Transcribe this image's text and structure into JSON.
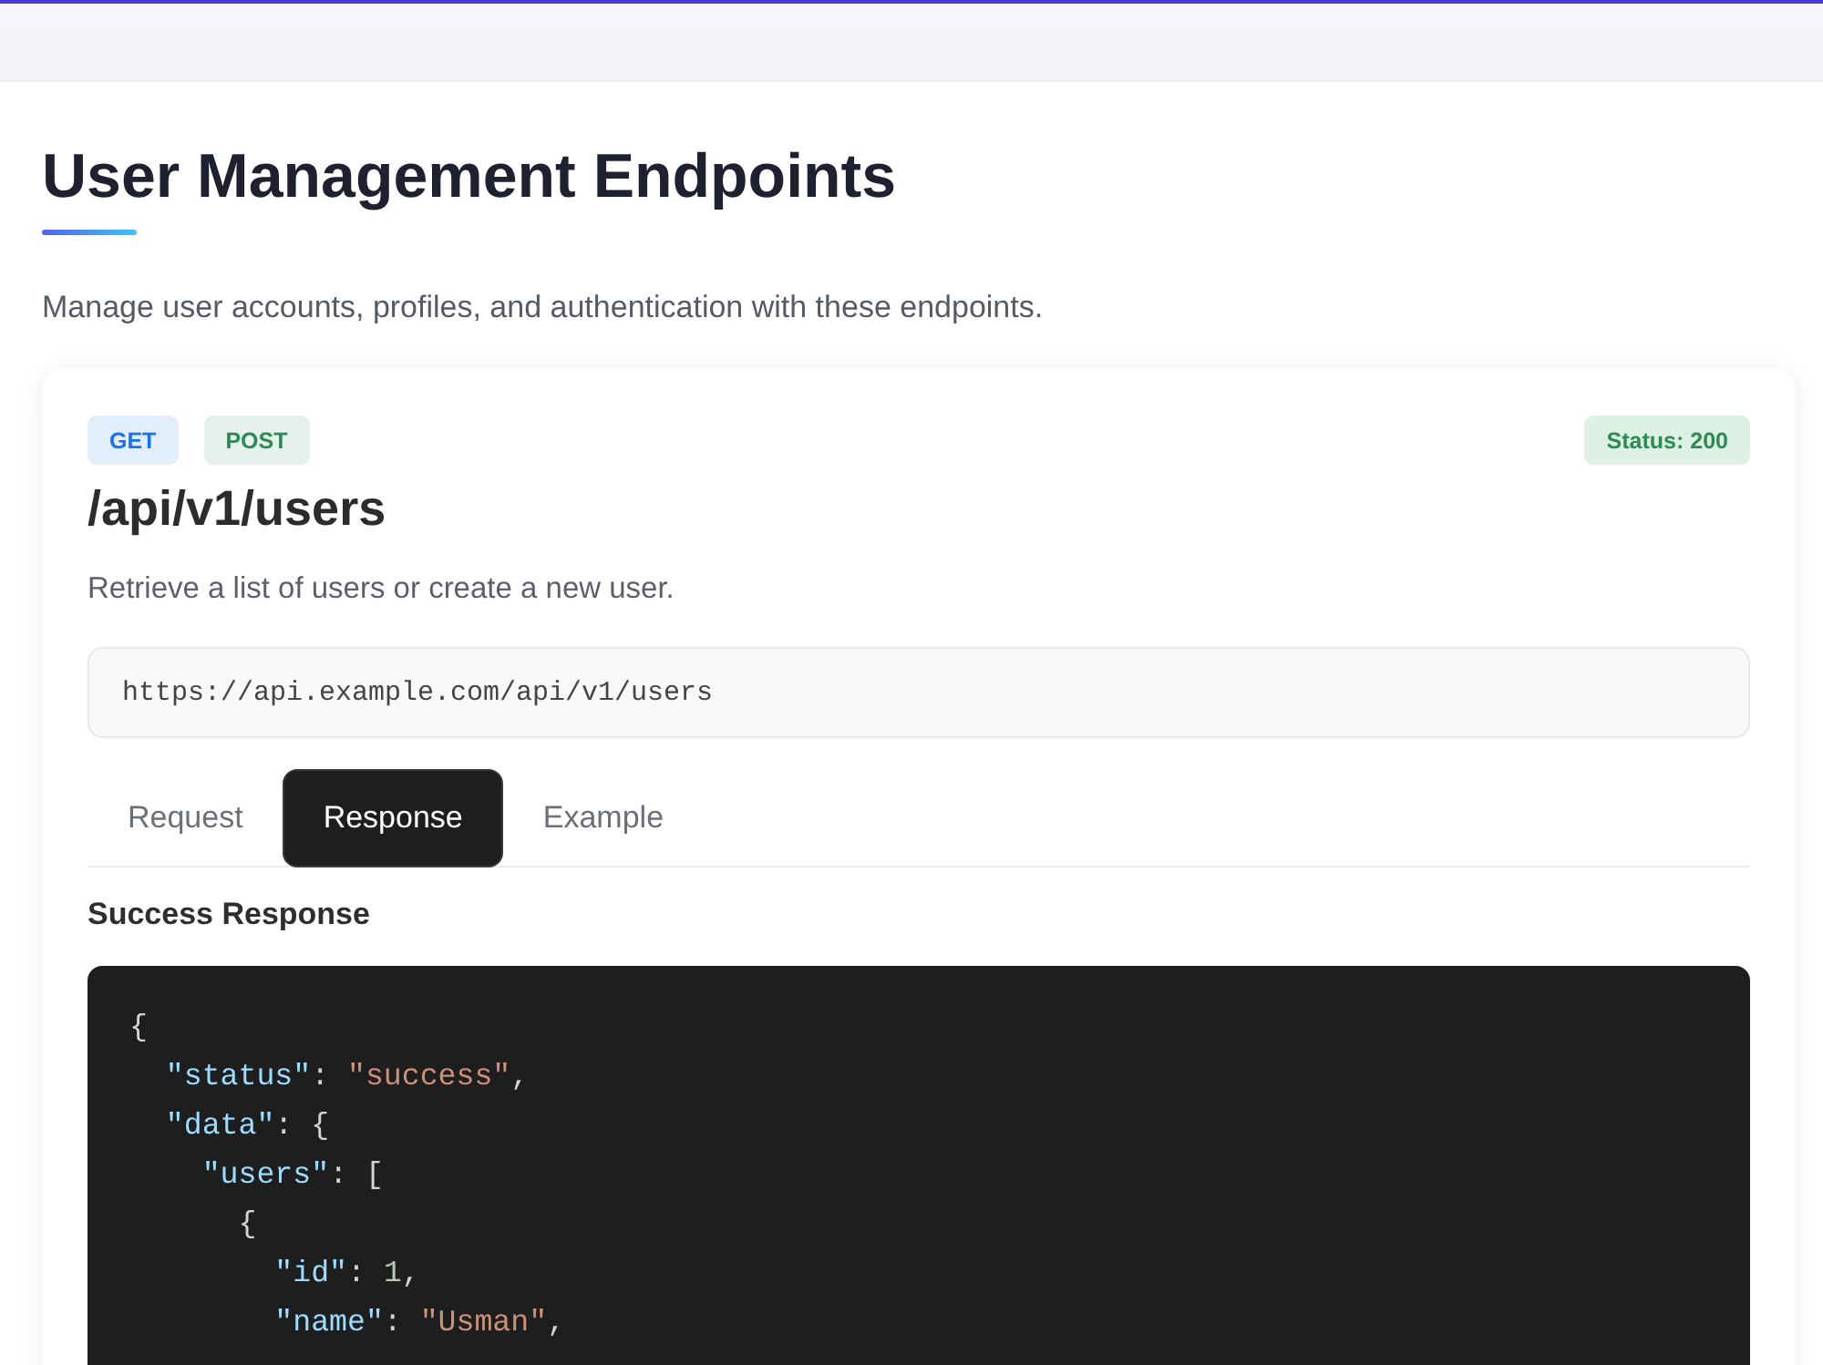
{
  "page": {
    "title": "User Management Endpoints",
    "subtitle": "Manage user accounts, profiles, and authentication with these endpoints."
  },
  "endpoint": {
    "methods": [
      {
        "label": "GET",
        "color": "#1a73e8"
      },
      {
        "label": "POST",
        "color": "#2b8a55"
      }
    ],
    "status": "Status: 200",
    "path": "/api/v1/users",
    "description": "Retrieve a list of users or create a new user.",
    "url": "https://api.example.com/api/v1/users",
    "tabs": [
      {
        "label": "Request",
        "selected": false
      },
      {
        "label": "Response",
        "selected": true
      },
      {
        "label": "Example",
        "selected": false
      }
    ],
    "section_title": "Success Response",
    "code_lines": [
      {
        "tokens": [
          {
            "kind": "punct",
            "text": "{"
          }
        ]
      },
      {
        "tokens": [
          {
            "kind": "key",
            "text": "  \"status\""
          },
          {
            "kind": "punct",
            "text": ": "
          },
          {
            "kind": "string",
            "text": "\"success\""
          },
          {
            "kind": "punct",
            "text": ","
          }
        ]
      },
      {
        "tokens": [
          {
            "kind": "key",
            "text": "  \"data\""
          },
          {
            "kind": "punct",
            "text": ": {"
          }
        ]
      },
      {
        "tokens": [
          {
            "kind": "key",
            "text": "    \"users\""
          },
          {
            "kind": "punct",
            "text": ": ["
          }
        ]
      },
      {
        "tokens": [
          {
            "kind": "punct",
            "text": "      {"
          }
        ]
      },
      {
        "tokens": [
          {
            "kind": "key",
            "text": "        \"id\""
          },
          {
            "kind": "punct",
            "text": ": "
          },
          {
            "kind": "number",
            "text": "1"
          },
          {
            "kind": "punct",
            "text": ","
          }
        ]
      },
      {
        "tokens": [
          {
            "kind": "key",
            "text": "        \"name\""
          },
          {
            "kind": "punct",
            "text": ": "
          },
          {
            "kind": "string",
            "text": "\"Usman\""
          },
          {
            "kind": "punct",
            "text": ","
          }
        ]
      }
    ]
  }
}
